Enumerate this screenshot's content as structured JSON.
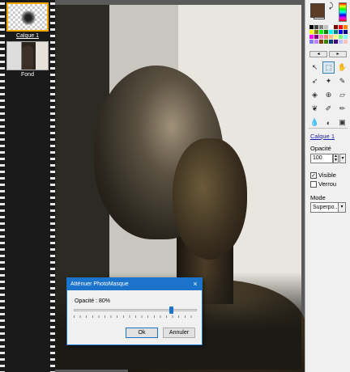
{
  "layers": [
    {
      "name": "Calque 1",
      "selected": true
    },
    {
      "name": "Fond",
      "selected": false
    }
  ],
  "dialog": {
    "title": "Atténuer PhotoMasque",
    "close_icon": "×",
    "opacity_label": "Opacité : 80%",
    "opacity_value": 80,
    "ok_label": "Ok",
    "cancel_label": "Annuler"
  },
  "palette": {
    "primary_color": "#5b3a26",
    "secondary_color": "#ffffff",
    "swap_icon": "⤸",
    "layer_name": "Calque 1",
    "opacity_label": "Opacité",
    "opacity_value": "100",
    "visible_label": "Visible",
    "visible_checked": true,
    "lock_label": "Verrou",
    "lock_checked": false,
    "mode_label": "Mode",
    "mode_value": "Superpo...",
    "tools": [
      {
        "name": "pointer-tool-icon",
        "glyph": "↖",
        "active": false
      },
      {
        "name": "selection-tool-icon",
        "glyph": "⬚",
        "active": true
      },
      {
        "name": "hand-tool-icon",
        "glyph": "✋",
        "active": false
      },
      {
        "name": "lasso-tool-icon",
        "glyph": "➶",
        "active": false
      },
      {
        "name": "magic-wand-icon",
        "glyph": "✦",
        "active": false
      },
      {
        "name": "eyedropper-icon",
        "glyph": "✎",
        "active": false
      },
      {
        "name": "bucket-icon",
        "glyph": "◈",
        "active": false
      },
      {
        "name": "clone-icon",
        "glyph": "⊕",
        "active": false
      },
      {
        "name": "eraser-icon",
        "glyph": "▱",
        "active": false
      },
      {
        "name": "recolor-icon",
        "glyph": "❦",
        "active": false
      },
      {
        "name": "brush-icon",
        "glyph": "✐",
        "active": false
      },
      {
        "name": "pencil-icon",
        "glyph": "✏",
        "active": false
      },
      {
        "name": "drop-icon",
        "glyph": "💧",
        "active": false
      },
      {
        "name": "burn-icon",
        "glyph": "◐",
        "active": false
      },
      {
        "name": "stamp-icon",
        "glyph": "▣",
        "active": false
      }
    ]
  },
  "swatch_colors": [
    "#000000",
    "#404040",
    "#808080",
    "#c0c0c0",
    "#ffffff",
    "#800000",
    "#ff0000",
    "#ff8000",
    "#ffff00",
    "#808000",
    "#00ff00",
    "#008000",
    "#00ffff",
    "#008080",
    "#0000ff",
    "#000080",
    "#ff00ff",
    "#800080",
    "#ff80c0",
    "#ff8080",
    "#ffc080",
    "#ffff80",
    "#80ff80",
    "#80ffff",
    "#8080ff",
    "#c080ff",
    "#804000",
    "#408000",
    "#004080",
    "#400080",
    "#c0c0ff",
    "#ffc0c0"
  ]
}
